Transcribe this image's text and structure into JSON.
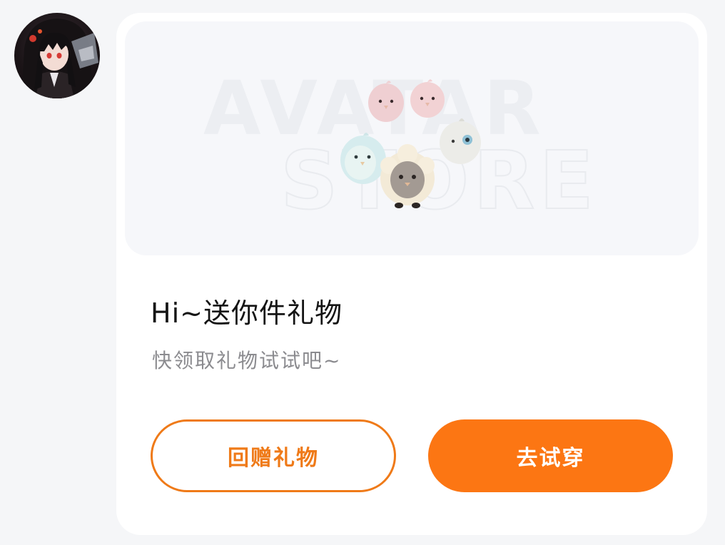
{
  "sender": {
    "avatar_icon": "anime-girl-avatar"
  },
  "card": {
    "banner": {
      "line1": "AVATAR",
      "line2": "STORE",
      "illustration_icon": "chick-plush-group"
    },
    "title": "Hi~送你件礼物",
    "subtitle": "快领取礼物试试吧~",
    "buttons": {
      "return_gift": "回赠礼物",
      "try_on": "去试穿"
    }
  },
  "colors": {
    "accent": "#fc7613",
    "accent_border": "#ef7a18",
    "background": "#f5f6f8",
    "card": "#ffffff"
  }
}
